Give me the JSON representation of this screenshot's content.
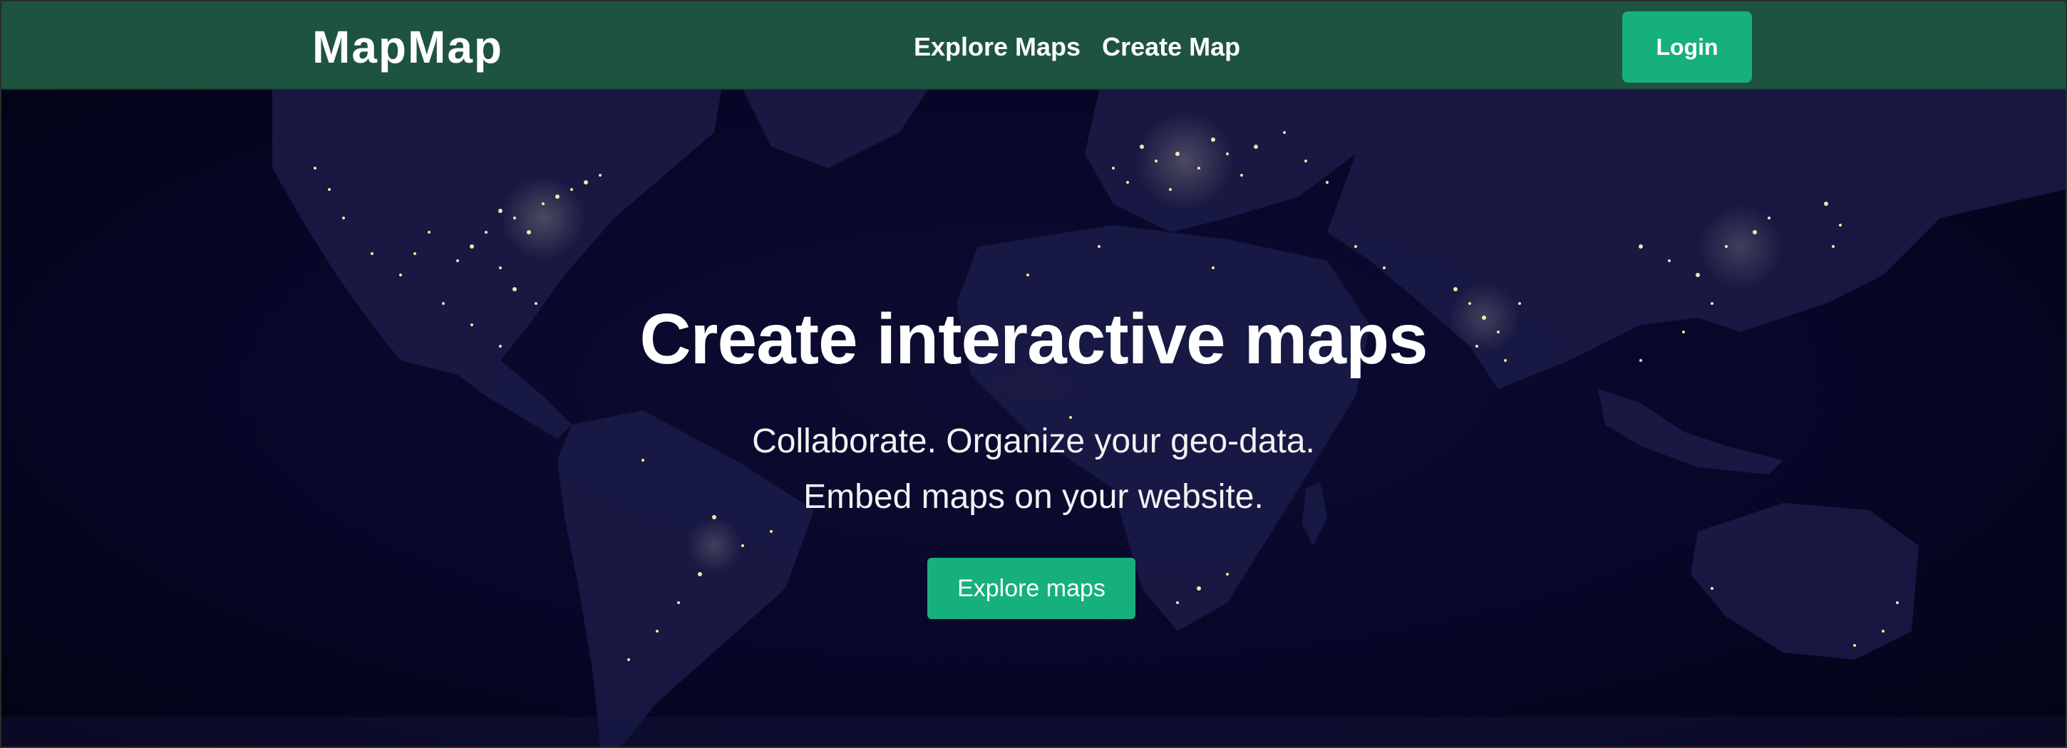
{
  "header": {
    "brand": "MapMap",
    "nav": [
      "Explore Maps",
      "Create Map"
    ],
    "login_label": "Login"
  },
  "hero": {
    "title": "Create interactive maps",
    "subtitle_line1": "Collaborate. Organize your geo-data.",
    "subtitle_line2": "Embed maps on your website.",
    "cta_label": "Explore maps",
    "background": "night-earth-map"
  },
  "colors": {
    "header_bg": "#1e5340",
    "accent": "#16b07c",
    "hero_bg": "#05051a",
    "city_lights": "#f3e7a6"
  }
}
